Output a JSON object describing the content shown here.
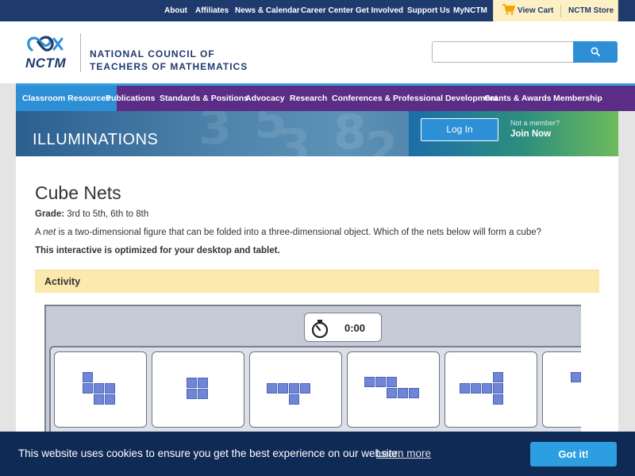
{
  "top_nav": {
    "links": [
      "About",
      "Affiliates",
      "News & Calendar",
      "Career Center",
      "Get Involved",
      "Support Us",
      "MyNCTM"
    ],
    "cart_label": "View Cart",
    "store_label": "NCTM Store"
  },
  "header": {
    "logo_abbrev": "NCTM",
    "org_line1": "NATIONAL COUNCIL OF",
    "org_line2": "TEACHERS OF MATHEMATICS",
    "search_value": ""
  },
  "main_nav": {
    "items": [
      "Classroom Resources",
      "Publications",
      "Standards & Positions",
      "Advocacy",
      "Research",
      "Conferences & Professional Development",
      "Grants & Awards",
      "Membership"
    ],
    "active_index": 0
  },
  "banner": {
    "title": "ILLUMINATIONS",
    "login_label": "Log In",
    "not_member": "Not a member?",
    "join_label": "Join Now"
  },
  "page": {
    "title": "Cube Nets",
    "grade_label": "Grade:",
    "grade_value": "3rd to 5th, 6th to 8th",
    "desc_pre": "A",
    "desc_term": "net",
    "desc_post": "is a two-dimensional figure that can be folded into a three-dimensional object. Which of the nets below will form a cube?",
    "optimized_note": "This interactive is optimized for your desktop and tablet.",
    "activity_label": "Activity"
  },
  "app": {
    "timer": "0:00"
  },
  "cookie": {
    "message": "This website uses cookies to ensure you get the best experience on our website.",
    "learn_more": "Learn more",
    "accept_label": "Got it!"
  },
  "colors": {
    "top_bar": "#1f3b6e",
    "nav_purple": "#5b2d86",
    "accent_blue": "#2d8fd5",
    "activity_bar": "#fce9ae",
    "cookie_bg": "#0f2a55"
  },
  "icons": [
    "cart-icon",
    "search-icon",
    "stopwatch-icon",
    "nctm-logo-icon"
  ]
}
